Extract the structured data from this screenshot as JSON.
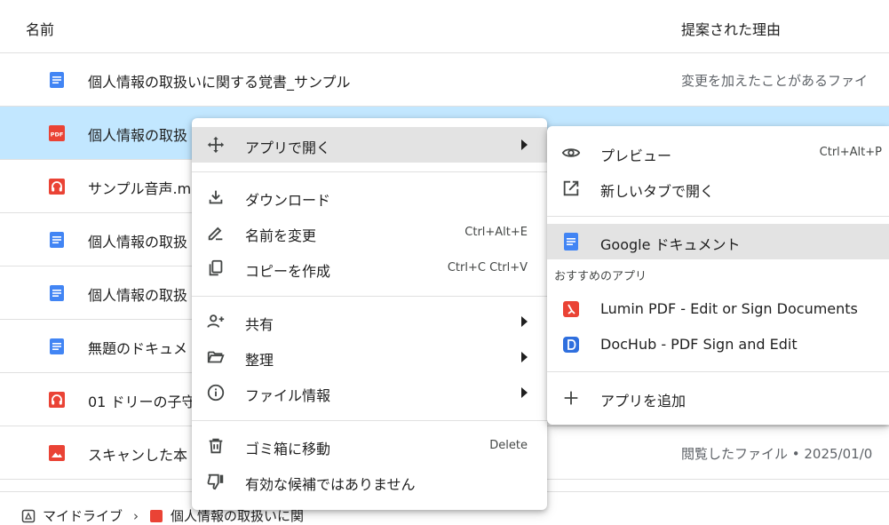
{
  "table": {
    "col_name": "名前",
    "col_reason": "提案された理由"
  },
  "files": [
    {
      "name": "個人情報の取扱いに関する覚書_サンプル",
      "reason": "変更を加えたことがあるファイ",
      "icon": "docs-icon",
      "color": "#4285f4"
    },
    {
      "name": "個人情報の取扱",
      "reason": "",
      "icon": "pdf-icon",
      "color": "#ea4335"
    },
    {
      "name": "サンプル音声.m",
      "reason": "",
      "icon": "audio-icon",
      "color": "#ea4335"
    },
    {
      "name": "個人情報の取扱",
      "reason": "",
      "icon": "docs-icon",
      "color": "#4285f4"
    },
    {
      "name": "個人情報の取扱",
      "reason": "",
      "icon": "docs-icon",
      "color": "#4285f4"
    },
    {
      "name": "無題のドキュメ",
      "reason": "",
      "icon": "docs-icon",
      "color": "#4285f4"
    },
    {
      "name": "01 ドリーの子守",
      "reason": "",
      "icon": "audio-icon",
      "color": "#ea4335"
    },
    {
      "name": "スキャンした本",
      "reason": "閲覧したファイル • 2025/01/0",
      "icon": "image-icon",
      "color": "#ea4335"
    }
  ],
  "breadcrumb": {
    "root": "マイドライブ",
    "separator": "›",
    "current": "個人情報の取扱いに関"
  },
  "context_menu": {
    "open_with": "アプリで開く",
    "download": "ダウンロード",
    "rename": "名前を変更",
    "rename_shortcut": "Ctrl+Alt+E",
    "copy": "コピーを作成",
    "copy_shortcut": "Ctrl+C Ctrl+V",
    "share": "共有",
    "organize": "整理",
    "file_info": "ファイル情報",
    "trash": "ゴミ箱に移動",
    "trash_shortcut": "Delete",
    "not_helpful": "有効な候補ではありません"
  },
  "submenu": {
    "preview": "プレビュー",
    "preview_shortcut": "Ctrl+Alt+P",
    "open_new_tab": "新しいタブで開く",
    "google_docs": "Google ドキュメント",
    "section_label": "おすすめのアプリ",
    "lumin": "Lumin PDF - Edit or Sign Documents",
    "dochub": "DocHub - PDF Sign and Edit",
    "add_app": "アプリを追加"
  },
  "colors": {
    "selected_row": "#c2e7ff",
    "docs_blue": "#4285f4",
    "red": "#ea4335",
    "menu_hover": "#e3e3e3"
  }
}
